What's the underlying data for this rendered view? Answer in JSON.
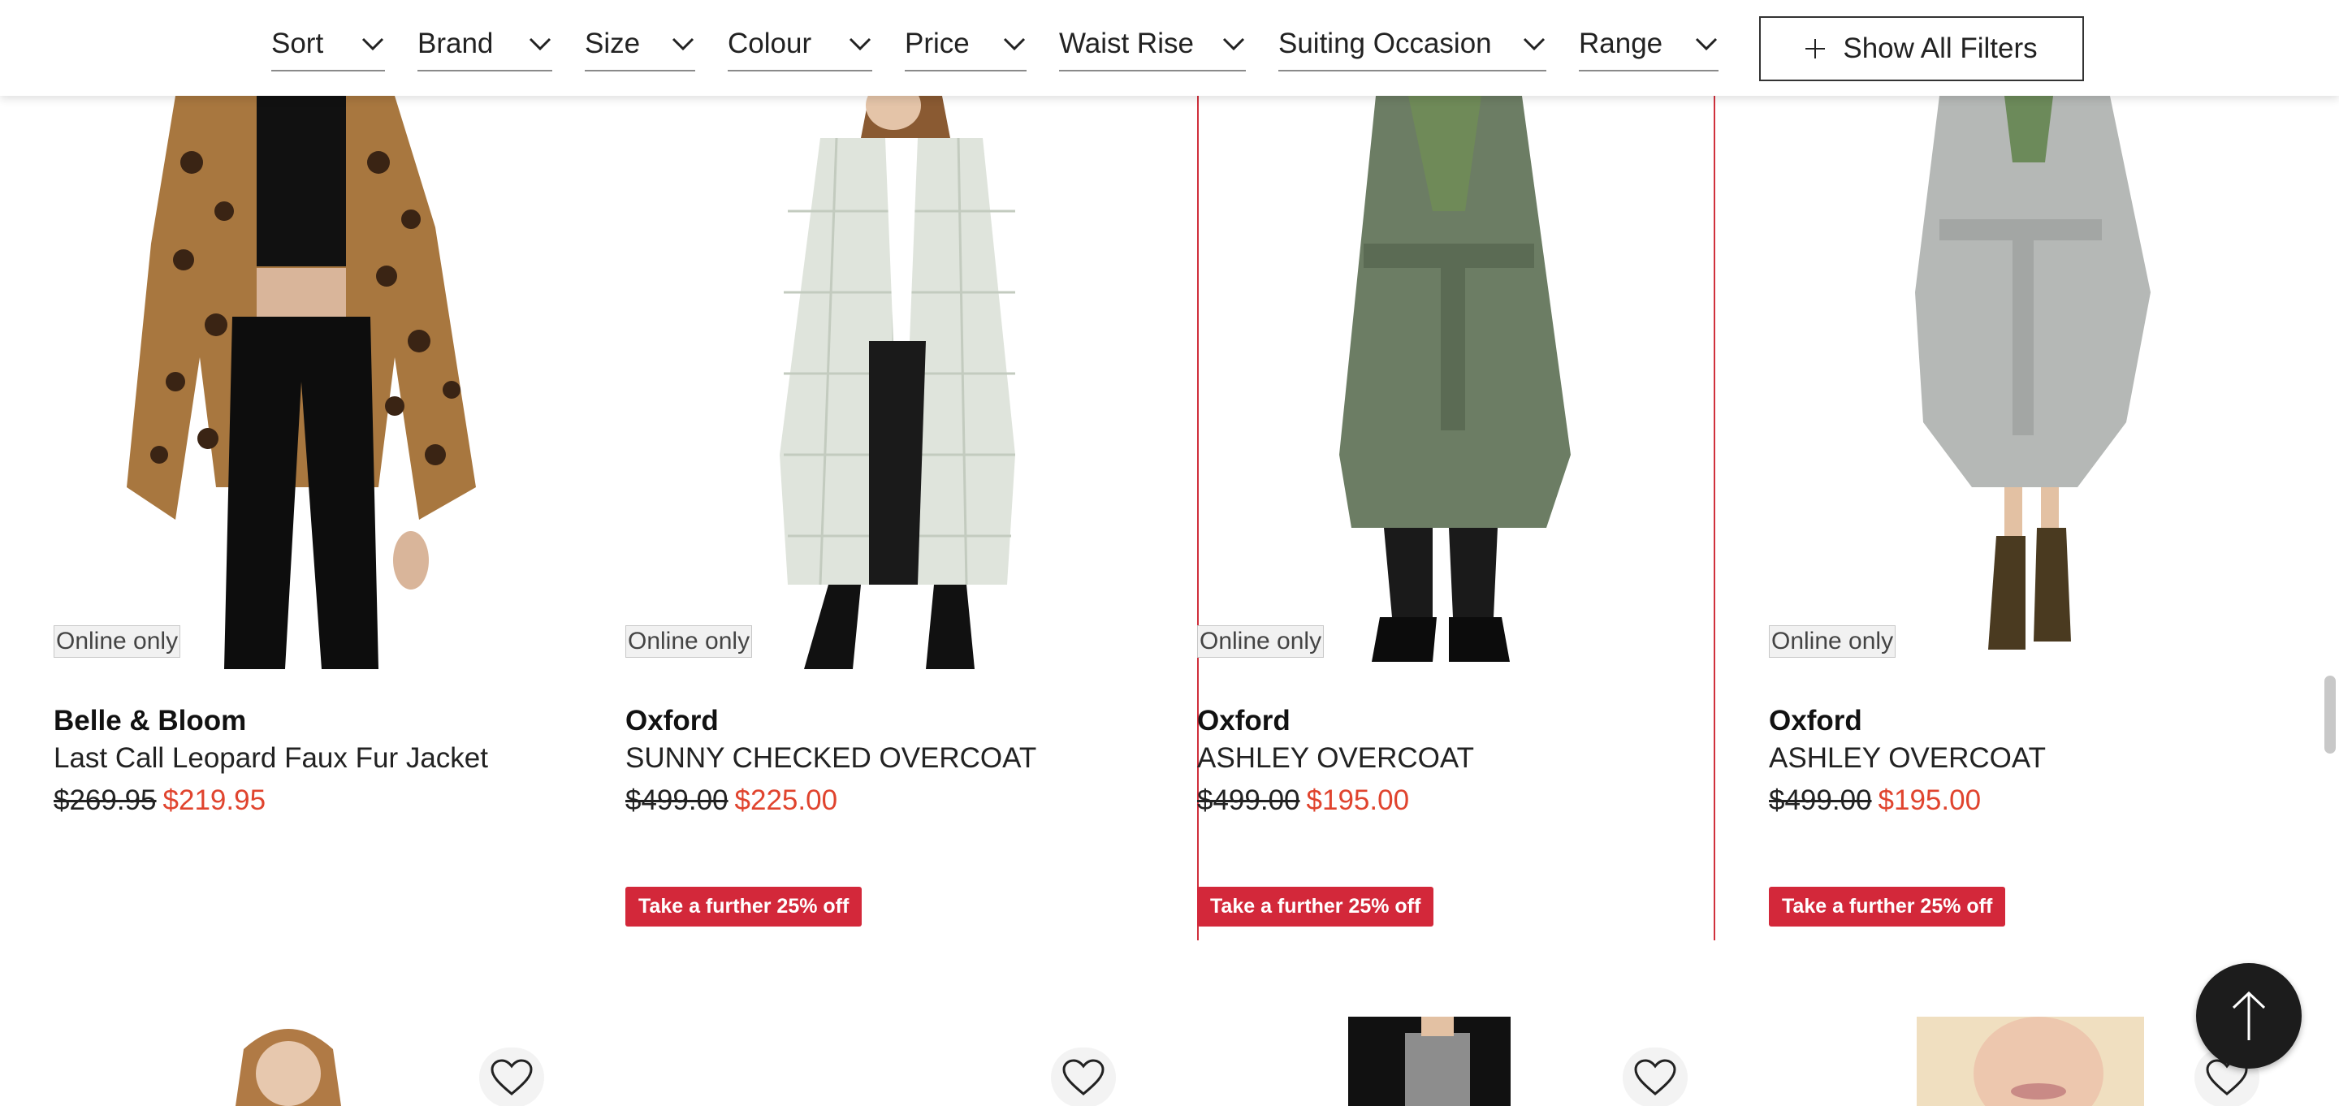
{
  "filters": [
    {
      "label": "Sort"
    },
    {
      "label": "Brand"
    },
    {
      "label": "Size"
    },
    {
      "label": "Colour"
    },
    {
      "label": "Price"
    },
    {
      "label": "Waist Rise"
    },
    {
      "label": "Suiting Occasion"
    },
    {
      "label": "Range"
    }
  ],
  "show_all_filters": "Show All Filters",
  "products": [
    {
      "tag": "Online only",
      "brand": "Belle & Bloom",
      "name": "Last Call Leopard Faux Fur Jacket",
      "was_price": "$269.95",
      "now_price": "$219.95",
      "promo": ""
    },
    {
      "tag": "Online only",
      "brand": "Oxford",
      "name": "SUNNY CHECKED OVERCOAT",
      "was_price": "$499.00",
      "now_price": "$225.00",
      "promo": "Take a further 25% off"
    },
    {
      "tag": "Online only",
      "brand": "Oxford",
      "name": "ASHLEY OVERCOAT",
      "was_price": "$499.00",
      "now_price": "$195.00",
      "promo": "Take a further 25% off"
    },
    {
      "tag": "Online only",
      "brand": "Oxford",
      "name": "ASHLEY OVERCOAT",
      "was_price": "$499.00",
      "now_price": "$195.00",
      "promo": "Take a further 25% off"
    }
  ],
  "colors": {
    "sale_price": "#e0442e",
    "promo_bg": "#d3283a",
    "active_card_border": "#d0303c"
  },
  "icons": {
    "filter_chevron": "chevron-down-icon",
    "show_all": "plus-icon",
    "wishlist": "heart-icon",
    "back_to_top": "arrow-up-icon"
  }
}
